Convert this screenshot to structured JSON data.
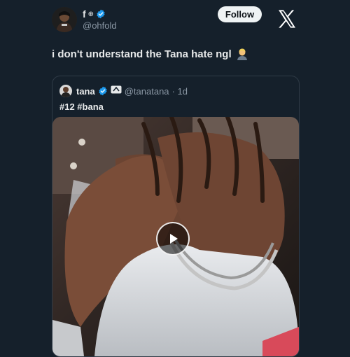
{
  "author": {
    "display_name": "f",
    "handle": "@ohfold",
    "follow_label": "Follow"
  },
  "tweet": {
    "text": "i don't understand the Tana hate ngl"
  },
  "quote": {
    "name": "tana",
    "handle": "@tanatana",
    "time": "· 1d",
    "text": "#12 #bana"
  },
  "icons": {
    "verified": "verified-badge-icon",
    "x_logo": "x-logo-icon",
    "play": "play-icon",
    "emoji": "blond-man-emoji-icon"
  },
  "colors": {
    "background": "#15202b",
    "verified": "#1d9bf0",
    "follow_bg": "#eff3f4"
  }
}
